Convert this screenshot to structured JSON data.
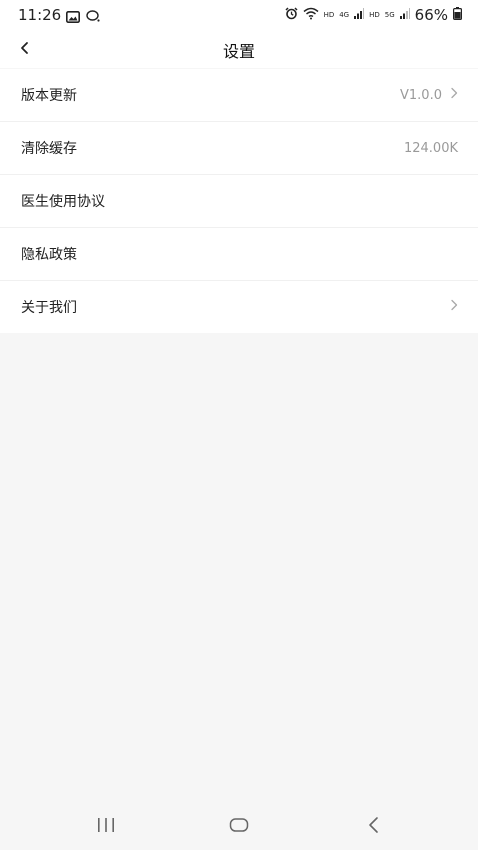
{
  "status_bar": {
    "time": "11:26",
    "net_hd_1": "HD",
    "net_4g": "4G",
    "net_hd_2": "HD",
    "net_5g": "5G",
    "battery": "66%",
    "icons": [
      "gallery-icon",
      "chat-bubble-icon",
      "alarm-icon",
      "wifi-icon",
      "signal-icon",
      "battery-icon"
    ]
  },
  "nav": {
    "title": "设置",
    "back_icon": "chevron-left-icon"
  },
  "settings": {
    "items": [
      {
        "label": "版本更新",
        "value": "V1.0.0",
        "chevron": true
      },
      {
        "label": "清除缓存",
        "value": "124.00K",
        "chevron": false
      },
      {
        "label": "医生使用协议",
        "value": "",
        "chevron": false
      },
      {
        "label": "隐私政策",
        "value": "",
        "chevron": false
      },
      {
        "label": "关于我们",
        "value": "",
        "chevron": true
      }
    ]
  },
  "system_nav": {
    "icons": [
      "recent-apps-icon",
      "home-icon",
      "back-icon"
    ]
  },
  "colors": {
    "background": "#f6f6f6",
    "surface": "#ffffff",
    "text_primary": "#222222",
    "text_secondary": "#9a9a9a"
  }
}
